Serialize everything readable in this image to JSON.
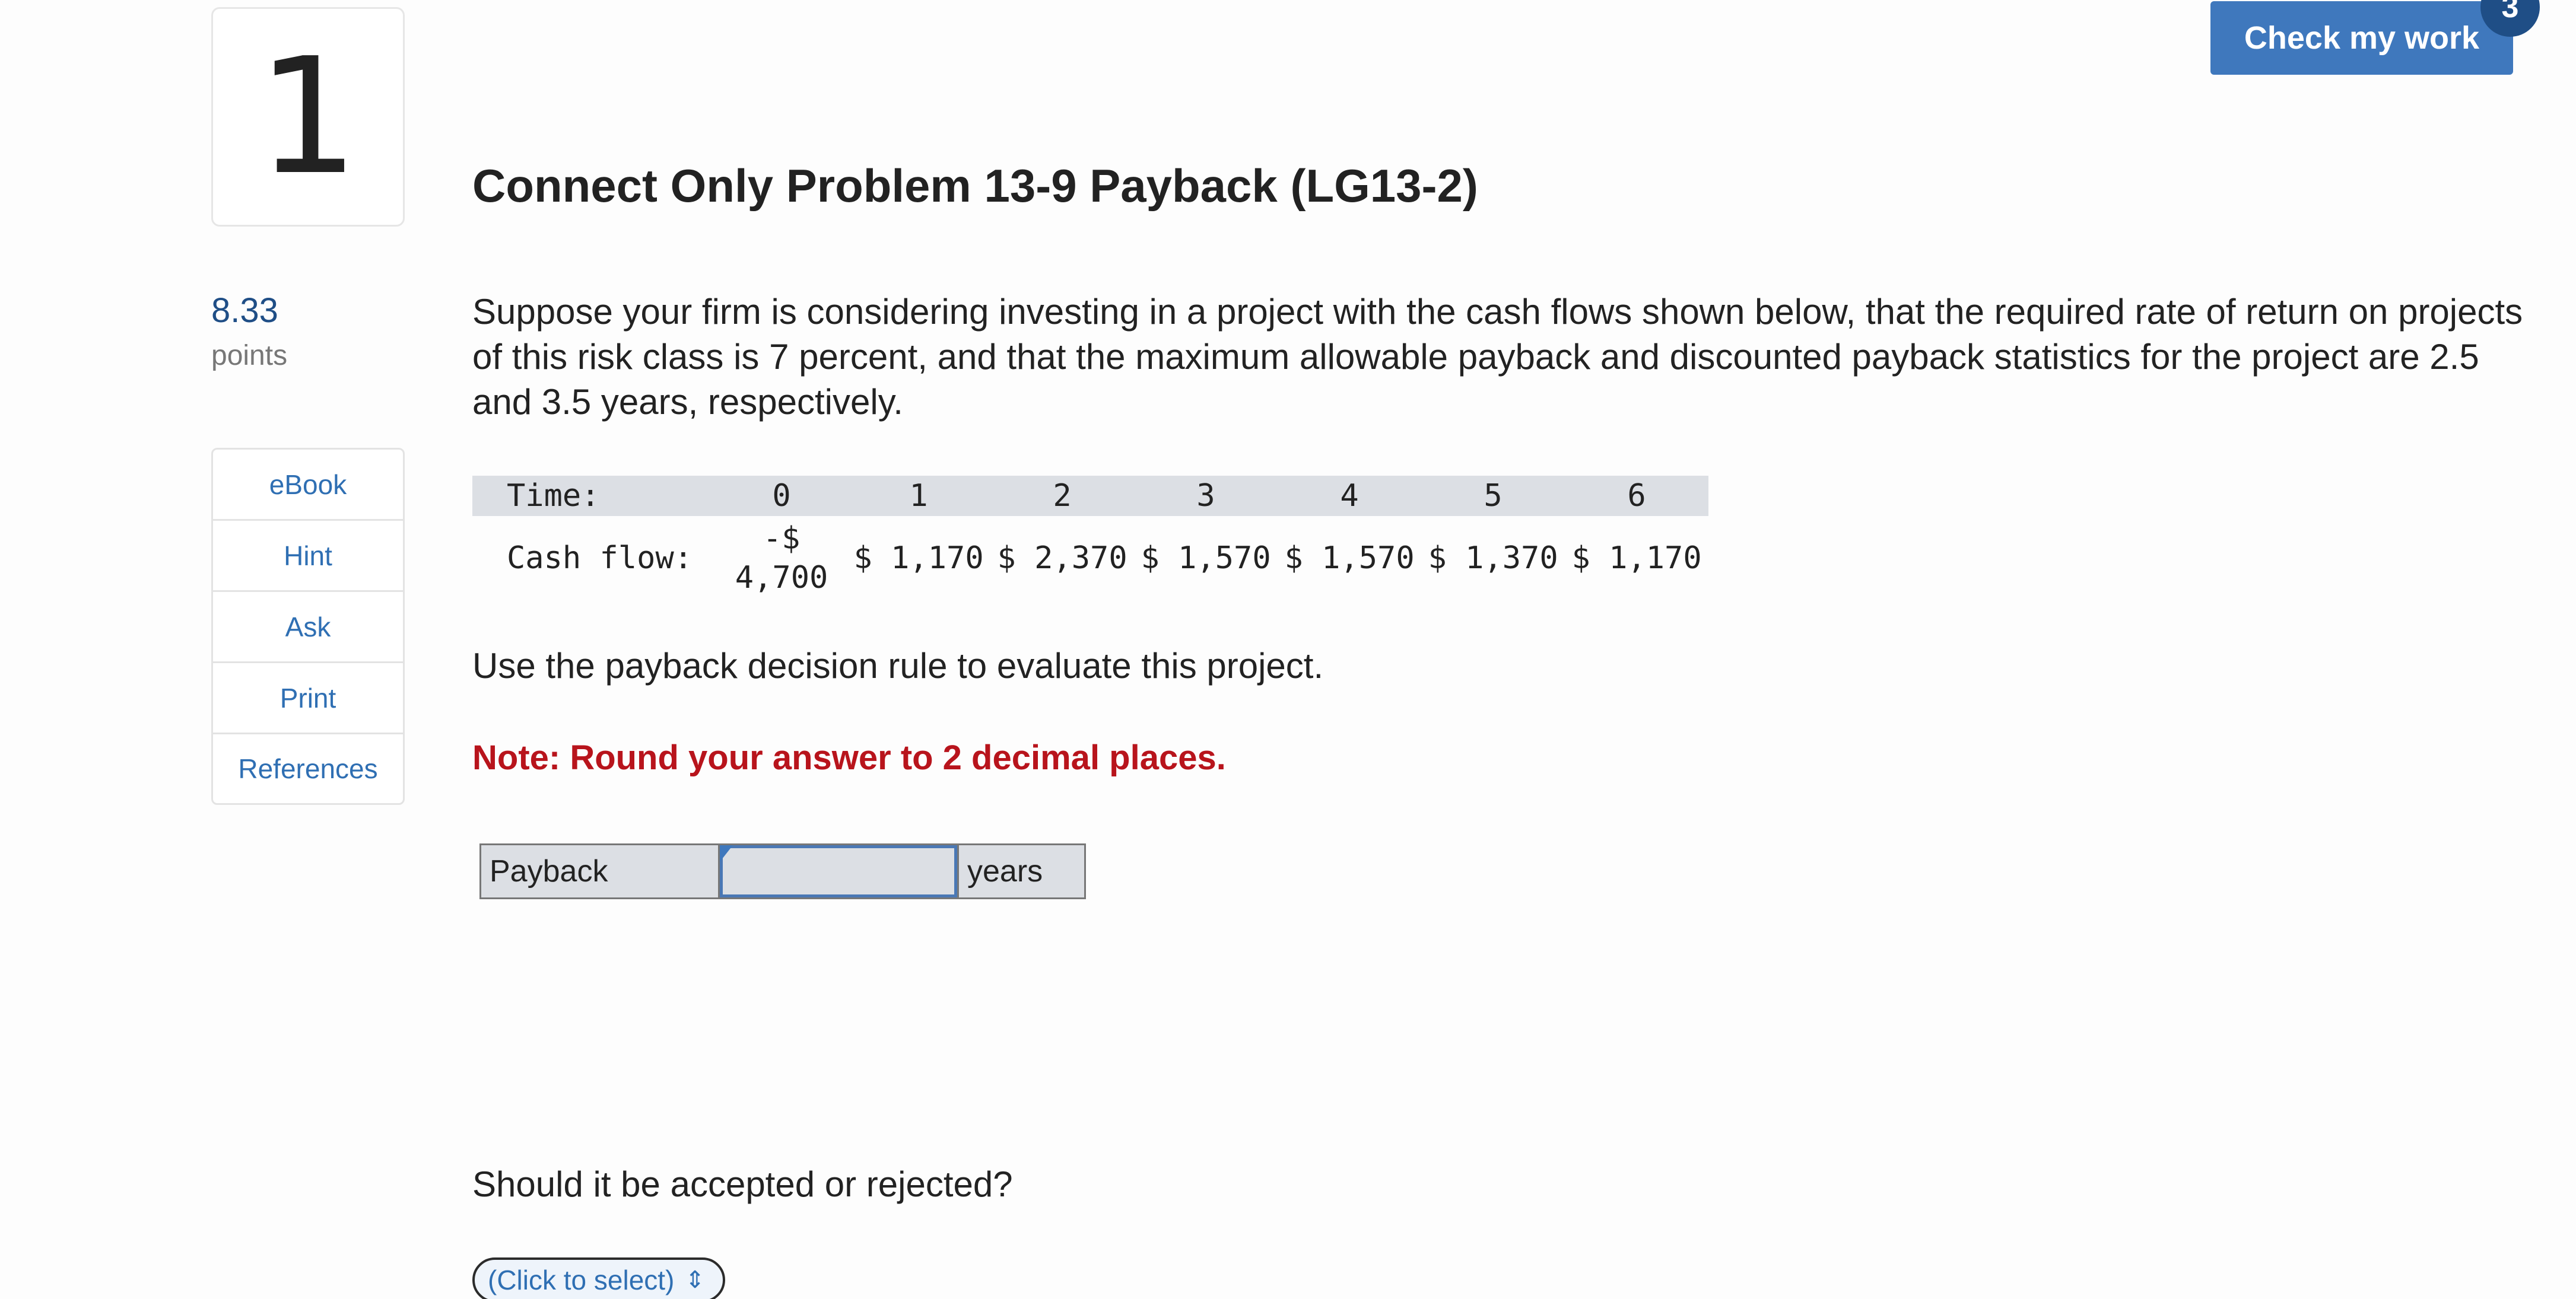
{
  "question": {
    "number": "1",
    "points_value": "8.33",
    "points_label": "points",
    "title": "Connect Only Problem 13-9 Payback (LG13-2)",
    "prompt": "Suppose your firm is considering investing in a project with the cash flows shown below, that the required rate of return on projects of this risk class is 7 percent, and that the maximum allowable payback and discounted payback statistics for the project are 2.5 and 3.5 years, respectively.",
    "instruction": "Use the payback decision rule to evaluate this project.",
    "note": "Note: Round your answer to 2 decimal places.",
    "question2": "Should it be accepted or rejected?"
  },
  "header": {
    "check_label": "Check my work",
    "check_badge": "3"
  },
  "side_menu": {
    "items": [
      "eBook",
      "Hint",
      "Ask",
      "Print",
      "References"
    ]
  },
  "cash_flow_table": {
    "time_label": "Time:",
    "flow_label": "Cash flow:",
    "periods": [
      "0",
      "1",
      "2",
      "3",
      "4",
      "5",
      "6"
    ],
    "flows": [
      "-$\n4,700",
      "$ 1,170",
      "$ 2,370",
      "$ 1,570",
      "$ 1,570",
      "$ 1,370",
      "$ 1,170"
    ]
  },
  "answer": {
    "label": "Payback",
    "value": "",
    "unit": "years"
  },
  "select": {
    "placeholder": "(Click to select)",
    "chevron": "⇕"
  }
}
